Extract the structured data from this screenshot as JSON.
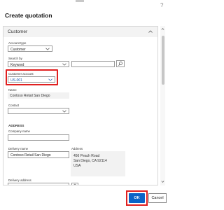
{
  "dialog": {
    "title": "Create quotation",
    "help_symbol": "?"
  },
  "customer_section": {
    "title": "Customer",
    "account_type": {
      "label": "Account type",
      "value": "Customer"
    },
    "search_by": {
      "label": "Search by",
      "value": "Keyword",
      "search_value": ""
    },
    "customer_account": {
      "label": "Customer account",
      "value": "US-001"
    },
    "name": {
      "label": "Name",
      "value": "Contoso Retail San Diego"
    },
    "contact": {
      "label": "Contact",
      "value": ""
    },
    "address_heading": "ADDRESS",
    "company_name": {
      "label": "Company name",
      "value": ""
    },
    "delivery_name": {
      "label": "Delivery name",
      "value": "Contoso Retail San Diego"
    },
    "address": {
      "label": "Address",
      "lines": [
        "456 Peach Road",
        "San Diego, CA 92114",
        "USA"
      ]
    },
    "delivery_address": {
      "label": "Delivery address",
      "value": ""
    }
  },
  "buttons": {
    "ok_label": "OK",
    "cancel_label": "Cancel"
  },
  "colors": {
    "accent": "#0a64c8",
    "highlight": "#e02020"
  }
}
